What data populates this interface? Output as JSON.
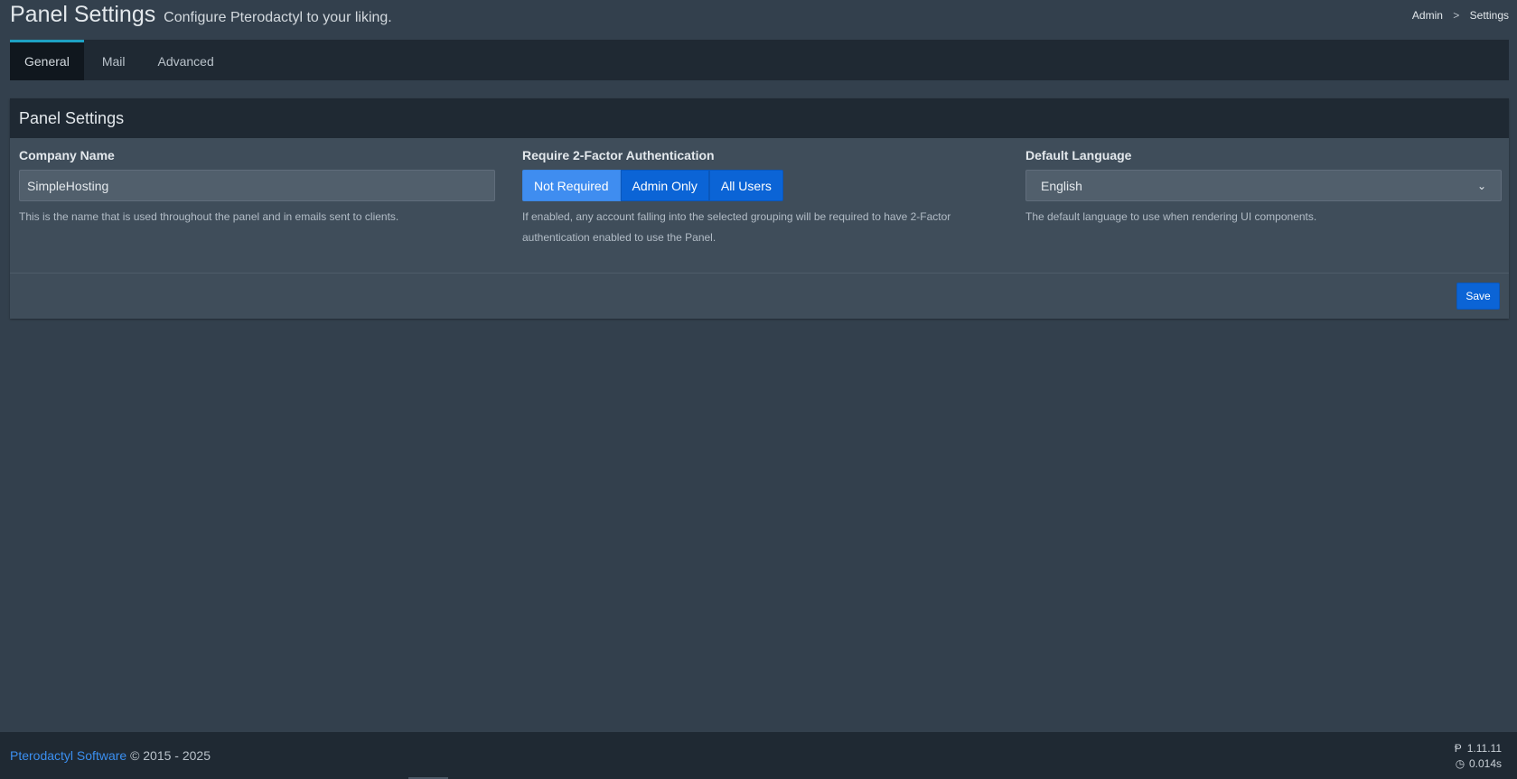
{
  "header": {
    "title": "Panel Settings",
    "subtitle": "Configure Pterodactyl to your liking.",
    "breadcrumb": {
      "root": "Admin",
      "separator": ">",
      "current": "Settings"
    }
  },
  "tabs": [
    {
      "label": "General",
      "active": true
    },
    {
      "label": "Mail",
      "active": false
    },
    {
      "label": "Advanced",
      "active": false
    }
  ],
  "box": {
    "title": "Panel Settings",
    "company": {
      "label": "Company Name",
      "value": "SimpleHosting",
      "help": "This is the name that is used throughout the panel and in emails sent to clients."
    },
    "two_factor": {
      "label": "Require 2-Factor Authentication",
      "options": [
        "Not Required",
        "Admin Only",
        "All Users"
      ],
      "selected": "Not Required",
      "help_line1": "If enabled, any account falling into the selected grouping will be required to have 2-Factor",
      "help_line2": "authentication enabled to use the Panel."
    },
    "language": {
      "label": "Default Language",
      "selected": "English",
      "help": "The default language to use when rendering UI components."
    },
    "save_label": "Save"
  },
  "footer": {
    "brand": "Pterodactyl Software",
    "copyright": "© 2015 - 2025",
    "version": "1.11.11",
    "render_time": "0.014s",
    "version_icon": "pterodactyl-p-icon",
    "time_icon": "clock-icon"
  },
  "colors": {
    "background": "#33404d",
    "panel": "#1f2933",
    "accent": "#1ea1c3",
    "primary": "#0b64d6",
    "link": "#3b8ff0"
  }
}
